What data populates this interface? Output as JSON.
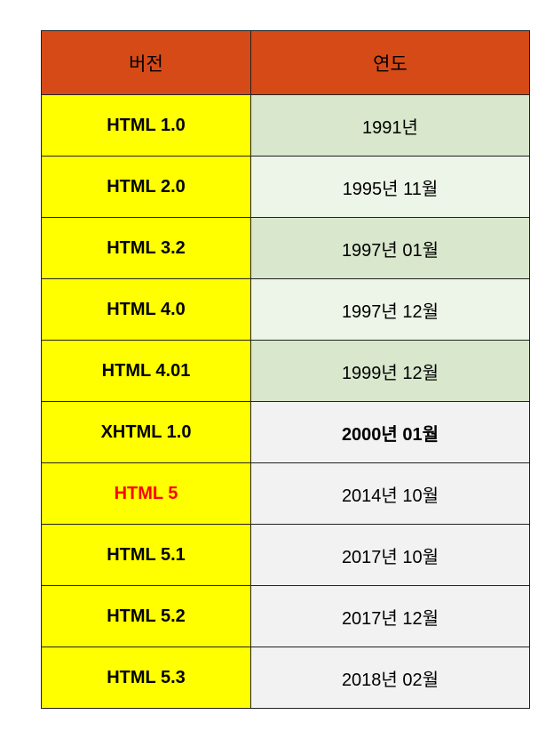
{
  "table": {
    "headers": {
      "version": "버전",
      "year": "연도"
    },
    "rows": [
      {
        "version": "HTML 1.0",
        "year": "1991년"
      },
      {
        "version": "HTML 2.0",
        "year": "1995년 11월"
      },
      {
        "version": "HTML 3.2",
        "year": "1997년 01월"
      },
      {
        "version": "HTML 4.0",
        "year": "1997년 12월"
      },
      {
        "version": "HTML 4.01",
        "year": "1999년 12월"
      },
      {
        "version": "XHTML 1.0",
        "year": "2000년 01월"
      },
      {
        "version": "HTML 5",
        "year": "2014년 10월"
      },
      {
        "version": "HTML 5.1",
        "year": "2017년 10월"
      },
      {
        "version": "HTML 5.2",
        "year": "2017년 12월"
      },
      {
        "version": "HTML 5.3",
        "year": "2018년 02월"
      }
    ]
  },
  "colors": {
    "header_bg": "#d64a17",
    "version_bg": "#ffff00",
    "highlight_text": "#ff0000",
    "year_green_dark": "#d9e7cc",
    "year_green_light": "#edf4e8",
    "year_gray": "#f2f2f2"
  }
}
